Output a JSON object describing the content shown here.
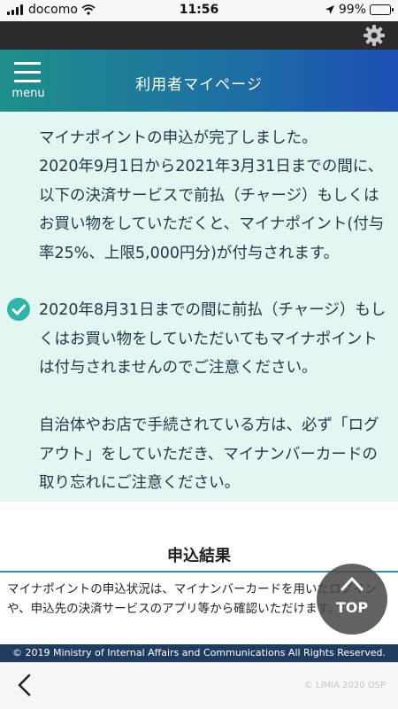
{
  "status_bar": {
    "carrier": "docomo",
    "time": "11:56",
    "battery_text": "99%",
    "battery_level": 0.99,
    "icons": [
      "signal-icon",
      "wifi-icon",
      "location-arrow-icon",
      "battery-icon"
    ]
  },
  "top_strip": {
    "icon": "gear-icon"
  },
  "header": {
    "menu_label": "menu",
    "title": "利用者マイページ",
    "gradient": [
      "#1f8f8a",
      "#1d6ea3",
      "#1c4fb5"
    ]
  },
  "notice": {
    "lines": [
      "マイナポイントの申込が完了しました。",
      "2020年9月1日から2021年3月31日までの間に、以下の決済サービスで前払（チャージ）もしくはお買い物をしていただくと、マイナポイント(付与率25%、上限5,000円分)が付与されます。",
      "2020年8月31日までの間に前払（チャージ）もしくはお買い物をしていただいてもマイナポイントは付与されませんのでご注意ください。",
      "自治体やお店で手続されている方は、必ず「ログアウト」をしていただき、マイナンバーカードの取り忘れにご注意ください。"
    ],
    "background": "#e3f6f1",
    "check_color": "#2fb5a6"
  },
  "result": {
    "title": "申込結果",
    "text": "マイナポイントの申込状況は、マイナンバーカードを用いたログインや、申込先の決済サービスのアプリ等から確認いただけます。"
  },
  "top_button": {
    "label": "TOP"
  },
  "footer": {
    "copyright": "© 2019 Ministry of Internal Affairs and Communications All Rights Reserved."
  },
  "toolbar": {
    "back_icon": "chevron-left-icon",
    "watermark": "© LIMIA 2020 OSP"
  }
}
